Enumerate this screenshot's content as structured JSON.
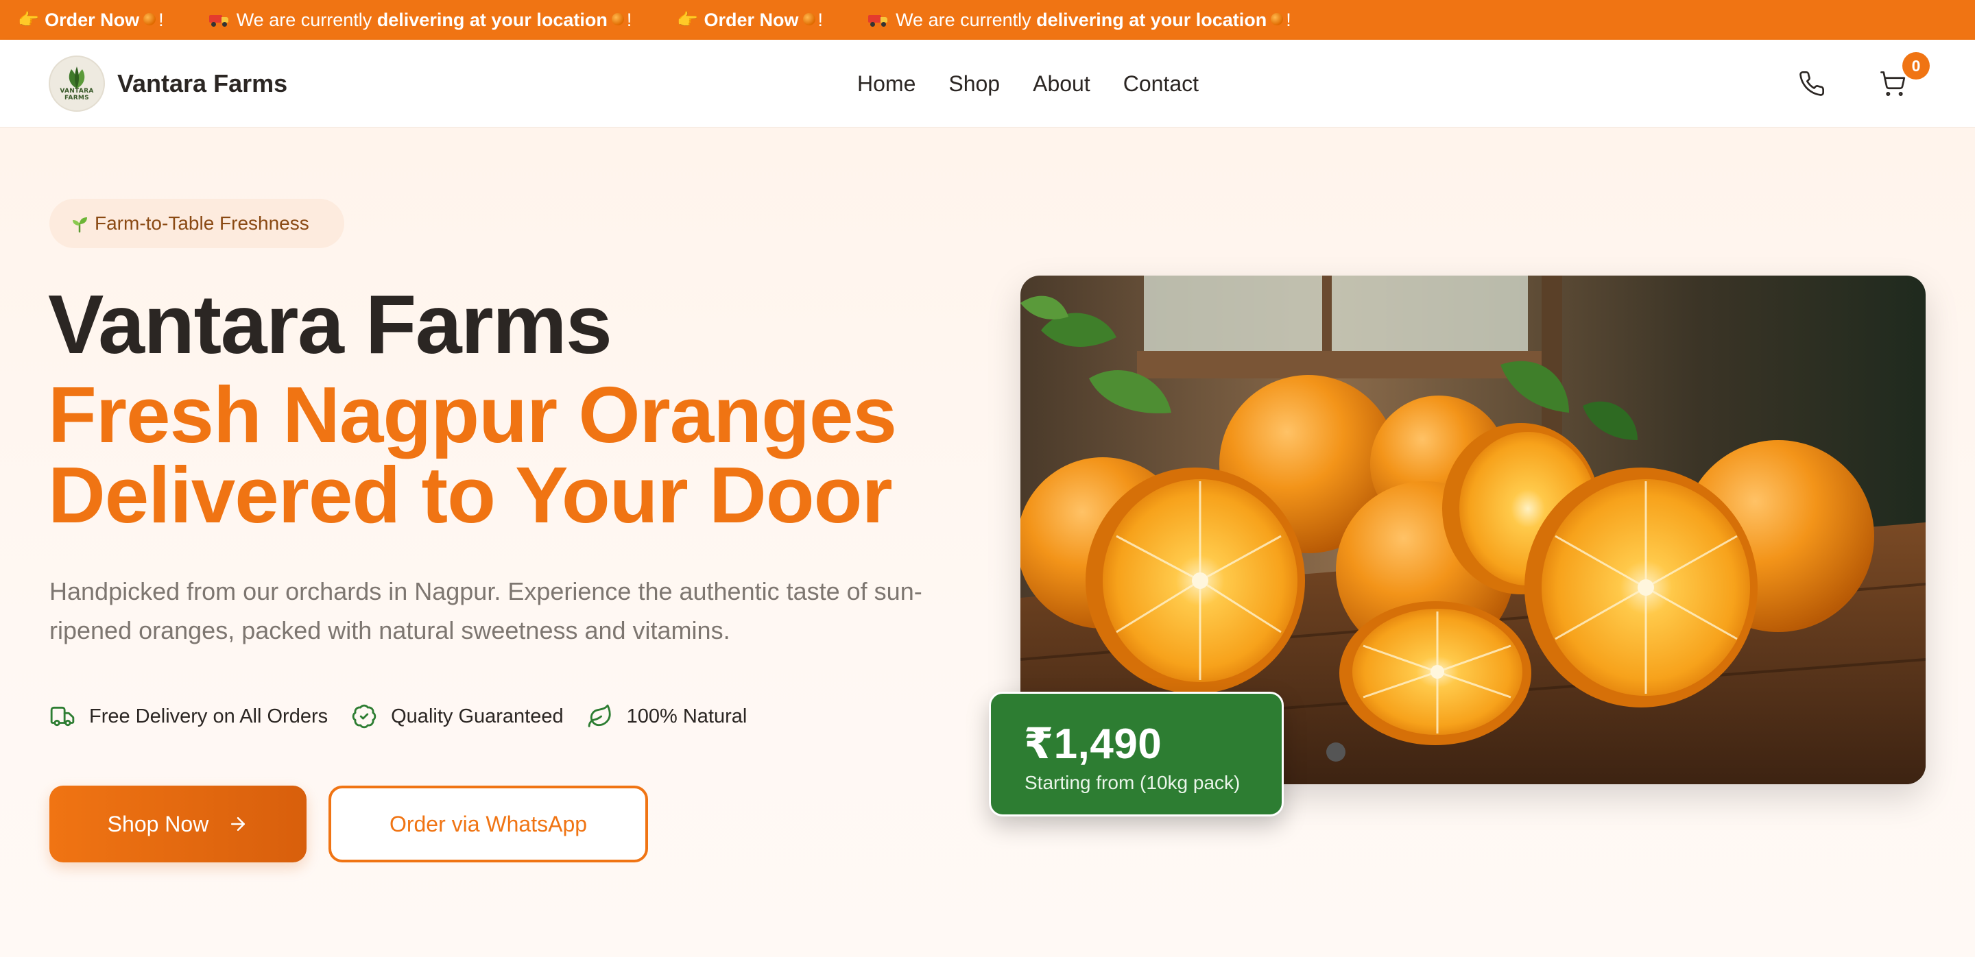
{
  "ticker": {
    "items": [
      {
        "prefix": "👉",
        "strong": "Order Now",
        "suffix": "!",
        "type": "order"
      },
      {
        "prefix": "🚚",
        "text": "We are currently ",
        "strong": "delivering at your location",
        "suffix": "!",
        "type": "delivery"
      },
      {
        "prefix": "👉",
        "strong": "Order Now",
        "suffix": "!",
        "type": "order"
      },
      {
        "prefix": "🚚",
        "text": "We are currently ",
        "strong": "delivering at your location",
        "suffix": "!",
        "type": "delivery"
      }
    ],
    "background": "#f07413"
  },
  "header": {
    "brand_name": "Vantara Farms",
    "logo_text": "VANTARA FARMS",
    "nav": [
      "Home",
      "Shop",
      "About",
      "Contact"
    ],
    "cart_count": "0",
    "icons": [
      "phone-icon",
      "cart-icon"
    ]
  },
  "hero": {
    "badge": "Farm-to-Table Freshness",
    "title": "Vantara Farms",
    "headline_line1": "Fresh Nagpur Oranges",
    "headline_line2": "Delivered to Your Door",
    "description": "Handpicked from our orchards in Nagpur. Experience the authentic taste of sun-ripened oranges, packed with natural sweetness and vitamins.",
    "features": [
      {
        "icon": "truck-icon",
        "label": "Free Delivery on All Orders"
      },
      {
        "icon": "badge-check-icon",
        "label": "Quality Guaranteed"
      },
      {
        "icon": "leaf-icon",
        "label": "100% Natural"
      }
    ],
    "primary_button": "Shop Now",
    "secondary_button": "Order via WhatsApp",
    "price": "₹1,490",
    "price_caption": "Starting from (10kg pack)"
  },
  "colors": {
    "accent": "#f07413",
    "green": "#2d7d32",
    "text": "#2b2623",
    "muted": "#7d7670"
  }
}
